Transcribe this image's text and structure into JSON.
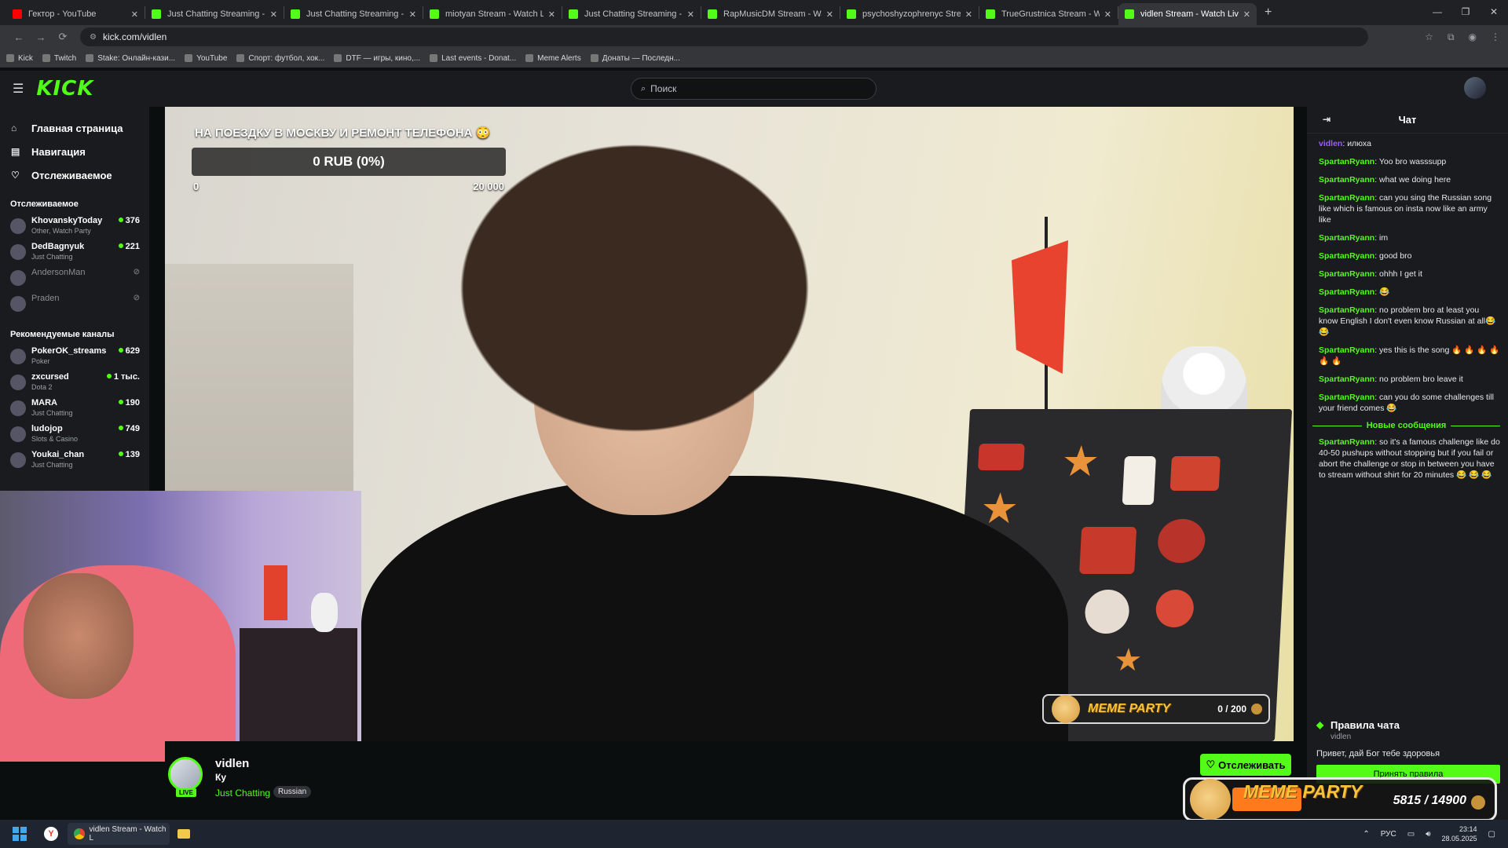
{
  "browser": {
    "tabs": [
      {
        "title": "Гектор - YouTube",
        "favicon": "youtube-icon",
        "active": false
      },
      {
        "title": "Just Chatting Streaming - Live S",
        "favicon": "kick-icon",
        "active": false
      },
      {
        "title": "Just Chatting Streaming - Live S",
        "favicon": "kick-icon",
        "active": false
      },
      {
        "title": "miotyan Stream - Watch Live on",
        "favicon": "kick-icon",
        "active": false
      },
      {
        "title": "Just Chatting Streaming - Live S",
        "favicon": "kick-icon",
        "active": false
      },
      {
        "title": "RapMusicDM Stream - Watch L",
        "favicon": "kick-icon",
        "active": false
      },
      {
        "title": "psychoshyzophrenyc Stream - W",
        "favicon": "kick-icon",
        "active": false
      },
      {
        "title": "TrueGrustnica Stream - Watch L",
        "favicon": "kick-icon",
        "active": false
      },
      {
        "title": "vidlen Stream - Watch Live",
        "favicon": "kick-icon",
        "active": true
      }
    ],
    "url": "kick.com/vidlen",
    "bookmarks": [
      "Kick",
      "Twitch",
      "Stake: Онлайн-кази...",
      "YouTube",
      "Спорт: футбол, хок...",
      "DTF — игры, кино,...",
      "Last events - Donat...",
      "Meme Alerts",
      "Донаты — Последн..."
    ]
  },
  "header": {
    "logo": "KICK",
    "search_placeholder": "Поиск"
  },
  "sidebar": {
    "nav": [
      {
        "label": "Главная страница",
        "icon": "home-icon"
      },
      {
        "label": "Навигация",
        "icon": "browse-icon"
      },
      {
        "label": "Отслеживаемое",
        "icon": "heart-icon"
      }
    ],
    "following_title": "Отслеживаемое",
    "following": [
      {
        "name": "KhovanskyToday",
        "category": "Other, Watch Party",
        "viewers": "376",
        "live": true
      },
      {
        "name": "DedBagnyuk",
        "category": "Just Chatting",
        "viewers": "221",
        "live": true
      },
      {
        "name": "AndersonMan",
        "category": "",
        "viewers": "",
        "live": false
      },
      {
        "name": "Praden",
        "category": "",
        "viewers": "",
        "live": false
      }
    ],
    "recommended_title": "Рекомендуемые каналы",
    "recommended": [
      {
        "name": "PokerOK_streams",
        "category": "Poker",
        "viewers": "629"
      },
      {
        "name": "zxcursed",
        "category": "Dota 2",
        "viewers": "1 тыс."
      },
      {
        "name": "MARA",
        "category": "Just Chatting",
        "viewers": "190"
      },
      {
        "name": "ludojop",
        "category": "Slots & Casino",
        "viewers": "749"
      },
      {
        "name": "Youkai_chan",
        "category": "Just Chatting",
        "viewers": "139"
      }
    ]
  },
  "stream": {
    "goal_title": "НА ПОЕЗДКУ В МОСКВУ И РЕМОНТ ТЕЛЕФОНА 😳",
    "goal_value": "0 RUB (0%)",
    "goal_min": "0",
    "goal_max": "20 000",
    "goal_progress": 0,
    "meme_small_name": "MEME PARTY",
    "meme_small_count": "0 / 200",
    "meme_small_progress": 0,
    "meme_big_name": "MEME PARTY",
    "meme_big_count": "5815 / 14900",
    "meme_big_progress": 0.39,
    "channel_name": "vidlen",
    "title": "Ку",
    "category": "Just Chatting",
    "tag": "Russian",
    "live_label": "LIVE",
    "follow_label": "Отслеживать"
  },
  "chat": {
    "title": "Чат",
    "messages": [
      {
        "user": "vidlen",
        "text": "илюха",
        "style": "purple"
      },
      {
        "user": "SpartanRyann",
        "text": "Yoo bro wasssupp"
      },
      {
        "user": "SpartanRyann",
        "text": "what we doing here"
      },
      {
        "user": "SpartanRyann",
        "text": "can you sing the Russian song like which is famous on insta now like an army like"
      },
      {
        "user": "SpartanRyann",
        "text": "im"
      },
      {
        "user": "SpartanRyann",
        "text": "good bro"
      },
      {
        "user": "SpartanRyann",
        "text": "ohhh I get it"
      },
      {
        "user": "SpartanRyann",
        "text": "😂"
      },
      {
        "user": "SpartanRyann",
        "text": "no problem bro at least you know English I don't even know Russian at all😂 😂"
      },
      {
        "user": "SpartanRyann",
        "text": "yes this is the song 🔥 🔥 🔥 🔥 🔥 🔥"
      },
      {
        "user": "SpartanRyann",
        "text": "no problem bro leave it"
      },
      {
        "user": "SpartanRyann",
        "text": "can you do some challenges till your friend comes 😂"
      }
    ],
    "new_messages_label": "Новые сообщения",
    "new_messages": [
      {
        "user": "SpartanRyann",
        "text": "so it's a famous challenge like do 40-50 pushups without stopping but if you fail or abort the challenge or stop in between you have to stream without shirt for 20 minutes 😂 😂 😂"
      }
    ],
    "rules_title": "Правила чата",
    "rules_channel": "vidlen",
    "rules_text": "Привет, дай Бог тебе здоровья",
    "accept_label": "Принять правила"
  },
  "taskbar": {
    "app_label": "vidlen Stream - Watch L",
    "lang": "РУС",
    "time": "23:14",
    "date": "28.05.2025"
  },
  "colors": {
    "brand_green": "#53fc18",
    "bg_dark": "#0b0e0f",
    "panel": "#191b1f"
  }
}
